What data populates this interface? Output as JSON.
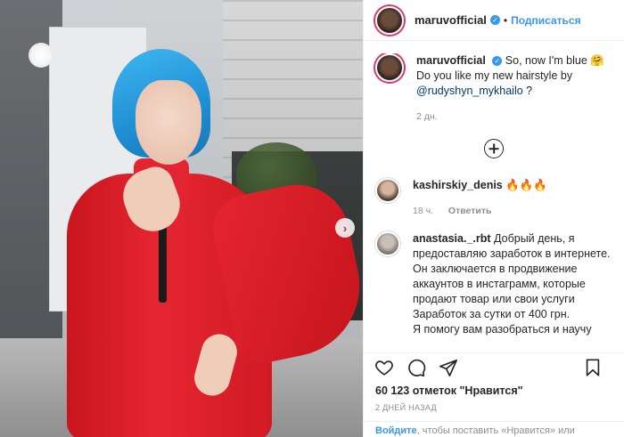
{
  "post": {
    "nav_next": "›"
  },
  "header": {
    "username": "maruvofficial",
    "verified_icon": "✓",
    "separator": "•",
    "follow_label": "Подписаться"
  },
  "caption": {
    "username": "maruvofficial",
    "text_line1": "So, now I'm blue 🤗",
    "text_line2": "Do you like my new hairstyle by",
    "mention": "@rudyshyn_mykhailo",
    "text_tail": " ?",
    "time": "2 дн."
  },
  "comments": [
    {
      "username": "kashirskiy_denis",
      "text": "🔥🔥🔥",
      "time": "18 ч.",
      "reply_label": "Ответить"
    },
    {
      "username": "anastasia._.rbt",
      "text": "Добрый день, я предоставляю заработок в интернете. Он заключается в продвижение аккаунтов в инстаграмм, которые продают товар или свои услуги",
      "text2": "Заработок за сутки от 400 грн.",
      "text3": "Я помогу вам разобраться и научу"
    }
  ],
  "stats": {
    "likes": "60 123 отметок \"Нравится\"",
    "date": "2 дней назад"
  },
  "footer": {
    "login_link": "Войдите",
    "login_text": ", чтобы поставить «Нравится» или"
  },
  "icons": {
    "like": "heart-icon",
    "comment": "comment-icon",
    "share": "share-icon",
    "save": "bookmark-icon",
    "add_comment": "plus-circle-icon"
  },
  "colors": {
    "accent": "#3897f0",
    "text": "#262626",
    "muted": "#8e8e8e"
  }
}
